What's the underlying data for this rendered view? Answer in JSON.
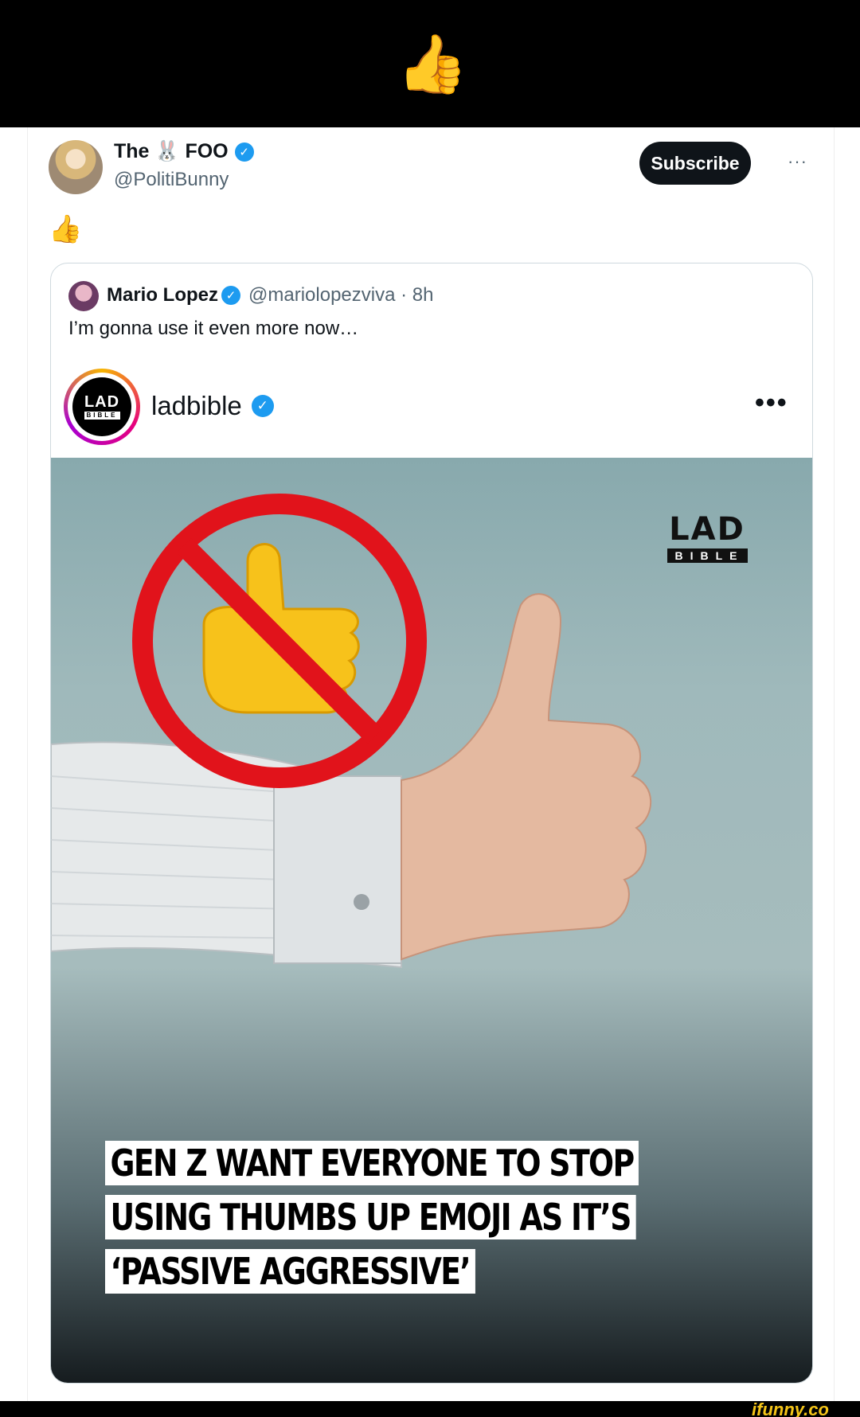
{
  "top_banner": {
    "emoji": "👍"
  },
  "tweet": {
    "author": {
      "name": "The 🐰 FOO",
      "handle": "@PolitiBunny",
      "verified_icon": "verified-badge-icon"
    },
    "subscribe_label": "Subscribe",
    "more_label": "···",
    "text_emoji": "👍",
    "quoted": {
      "author_name": "Mario Lopez",
      "handle_time": "@mariolopezviva · 8h",
      "text": "I’m gonna use it even more now…",
      "embedded": {
        "account_name": "ladbible",
        "logo_top": "LAD",
        "logo_bottom": "BIBLE",
        "more_label": "•••",
        "watermark_top": "LAD",
        "watermark_bottom": "BIBLE",
        "headline_lines": [
          "GEN Z WANT EVERYONE TO STOP",
          "USING THUMBS UP EMOJI AS IT’S",
          "‘PASSIVE AGGRESSIVE’"
        ]
      }
    }
  },
  "footer": {
    "watermark": "ifunny.co"
  },
  "colors": {
    "verified": "#1d9bf0",
    "subscribe_bg": "#0f1419",
    "prohibition_red": "#e1131b",
    "emoji_yellow": "#f7c21b",
    "ifunny_yellow": "#f5c518"
  }
}
